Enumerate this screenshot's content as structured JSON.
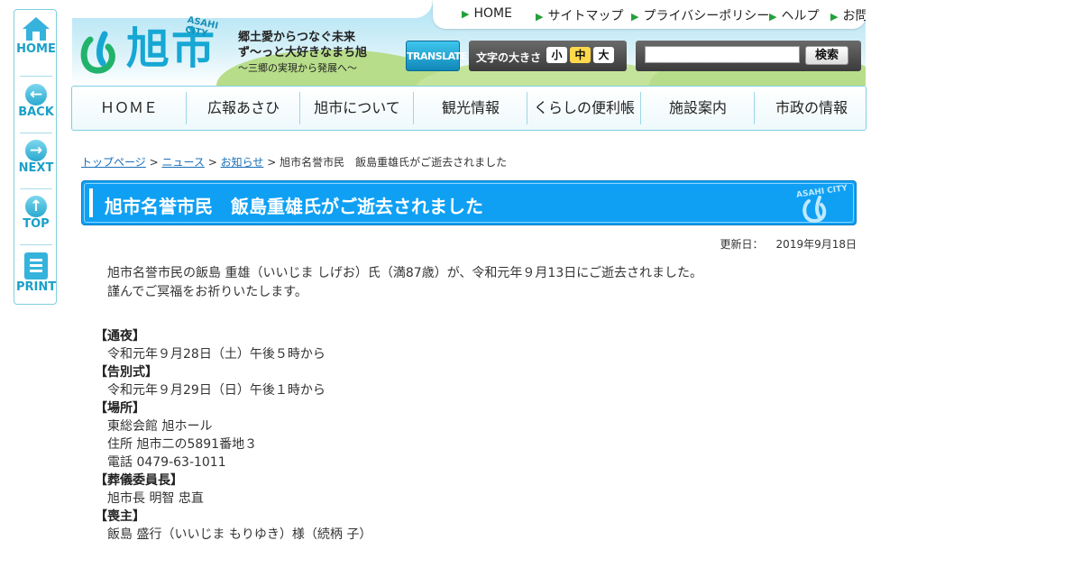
{
  "side_nav": {
    "items": [
      {
        "label": "HOME",
        "icon": "home-icon"
      },
      {
        "label": "BACK",
        "icon": "arrow-left-icon"
      },
      {
        "label": "NEXT",
        "icon": "arrow-right-icon"
      },
      {
        "label": "TOP",
        "icon": "arrow-up-icon"
      },
      {
        "label": "PRINT",
        "icon": "print-icon"
      }
    ]
  },
  "header": {
    "logo_name": "旭市",
    "logo_en": "ASAHI CITY",
    "tagline": [
      "郷土愛からつなぐ未来",
      "ず〜っと大好きなまち旭",
      "～三郷の実現から発展へ～"
    ],
    "translate_label": "TRANSLATE",
    "font_size_label": "文字の大きさ",
    "font_size_options": [
      "小",
      "中",
      "大"
    ],
    "font_size_selected": "中",
    "search_value": "",
    "search_button": "検索"
  },
  "top_nav": [
    "HOME",
    "サイトマップ",
    "プライバシーポリシー",
    "ヘルプ",
    "お問い合わせ"
  ],
  "global_nav": [
    "ＨＯＭＥ",
    "広報あさひ",
    "旭市について",
    "観光情報",
    "くらしの便利帳",
    "施設案内",
    "市政の情報"
  ],
  "breadcrumb": {
    "links": [
      "トップページ",
      "ニュース",
      "お知らせ"
    ],
    "separator": ">",
    "current": "旭市名誉市民　飯島重雄氏がご逝去されました"
  },
  "page": {
    "title": "旭市名誉市民　飯島重雄氏がご逝去されました",
    "title_logo_text": "ASAHI CITY",
    "updated_label": "更新日：",
    "updated_value": "2019年9月18日",
    "body": [
      "旭市名誉市民の飯島 重雄（いいじま しげお）氏（満87歳）が、令和元年９月13日にご逝去されました。",
      "謹んでご冥福をお祈りいたします。"
    ],
    "details": [
      {
        "heading": "【通夜】",
        "values": [
          "令和元年９月28日（土）午後５時から"
        ]
      },
      {
        "heading": "【告別式】",
        "values": [
          "令和元年９月29日（日）午後１時から"
        ]
      },
      {
        "heading": "【場所】",
        "values": [
          "東総会館 旭ホール",
          "住所 旭市二の5891番地３",
          "電話 0479-63-1011"
        ]
      },
      {
        "heading": "【葬儀委員長】",
        "values": [
          "旭市長 明智 忠直"
        ]
      },
      {
        "heading": "【喪主】",
        "values": [
          "飯島 盛行（いいじま もりゆき）様（続柄 子）"
        ]
      }
    ]
  },
  "colors": {
    "accent": "#0fa0f4",
    "brand": "#16a7d4",
    "link": "#1a6fb7"
  }
}
